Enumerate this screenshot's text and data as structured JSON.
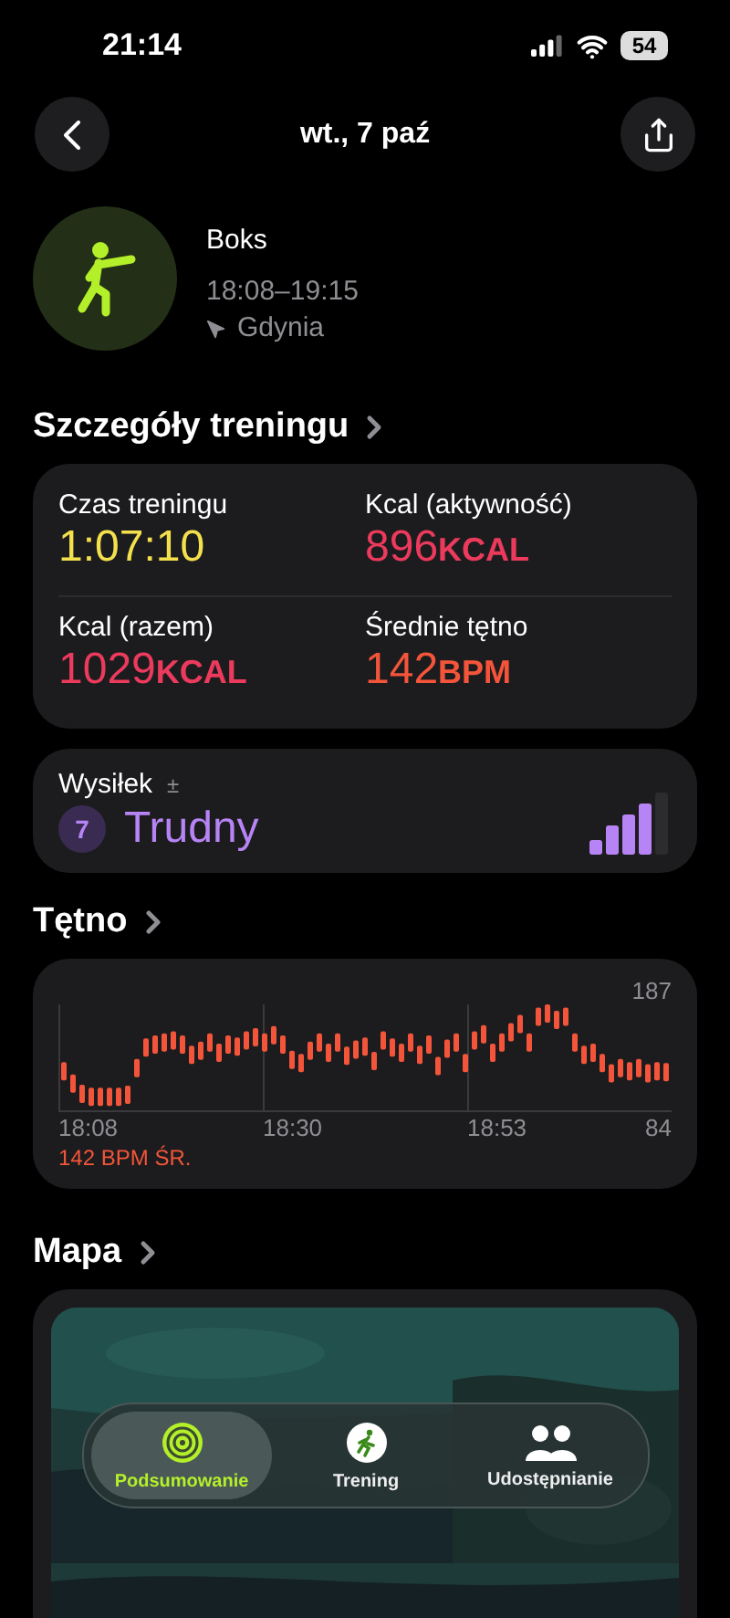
{
  "status_bar": {
    "time": "21:14",
    "battery": "54"
  },
  "nav": {
    "title": "wt., 7 paź"
  },
  "workout": {
    "name": "Boks",
    "time_range": "18:08–19:15",
    "location": "Gdynia"
  },
  "details": {
    "title": "Szczegóły treningu",
    "metrics": [
      {
        "label": "Czas treningu",
        "value": "1:07:10",
        "color": "#f4e04d"
      },
      {
        "label": "Kcal (aktywność)",
        "value": "896",
        "unit": "KCAL",
        "color": "#ec3a5d"
      },
      {
        "label": "Kcal (razem)",
        "value": "1029",
        "unit": "KCAL",
        "color": "#ec3a5d"
      },
      {
        "label": "Średnie tętno",
        "value": "142",
        "unit": "BPM",
        "color": "#f4553a"
      }
    ]
  },
  "effort": {
    "label": "Wysiłek",
    "symbol": "±",
    "score": "7",
    "rating": "Trudny",
    "level": 0.8
  },
  "heart_rate": {
    "title": "Tętno",
    "max_label": "187",
    "time_labels": [
      "18:08",
      "18:30",
      "18:53"
    ],
    "min_label": "84",
    "average": "142 BPM ŚR."
  },
  "map": {
    "title": "Mapa",
    "kind": "picture"
  },
  "tab_bar": [
    {
      "label": "Podsumowanie",
      "kind": "summary",
      "selected": true
    },
    {
      "label": "Trening",
      "kind": "workout",
      "selected": false
    },
    {
      "label": "Udostępnianie",
      "kind": "sharing",
      "selected": false
    }
  ]
}
